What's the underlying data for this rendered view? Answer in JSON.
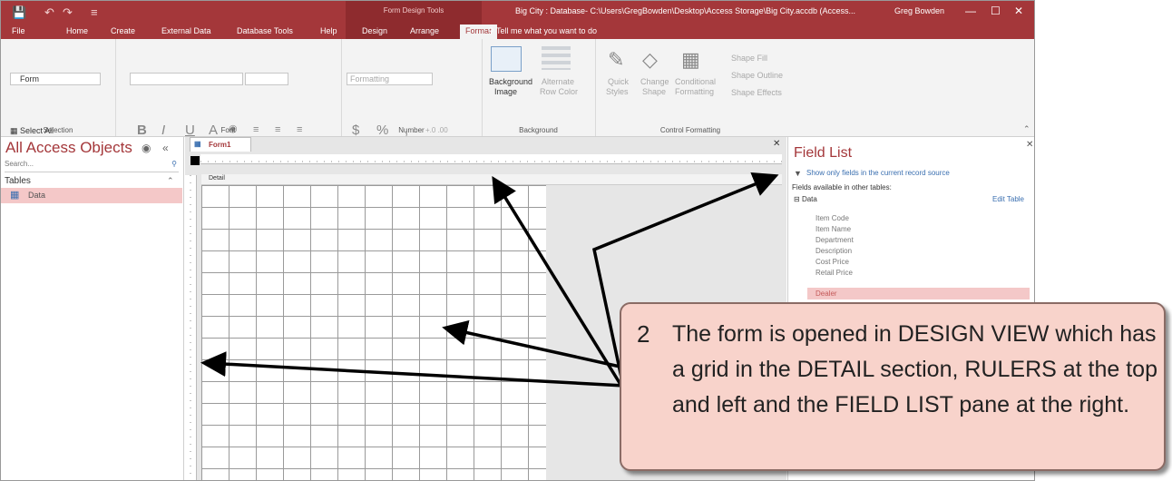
{
  "app": {
    "context_title": "Form Design Tools",
    "doc_title": "Big City : Database- C:\\Users\\GregBowden\\Desktop\\Access Storage\\Big City.accdb (Access...",
    "user": "Greg Bowden"
  },
  "tabs": [
    "File",
    "Home",
    "Create",
    "External Data",
    "Database Tools",
    "Help",
    "Design",
    "Arrange",
    "Format"
  ],
  "active_tab": "Format",
  "tell_me": "Tell me what you want to do",
  "ribbon": {
    "selection": {
      "object_value": "Form",
      "select_all": "Select All",
      "label": "Selection"
    },
    "font": {
      "bold": "B",
      "italic": "I",
      "underline": "U",
      "font_color": "A",
      "label": "Font"
    },
    "number": {
      "format_value": "Formatting",
      "currency": "$",
      "percent": "%",
      "comma": ",",
      "inc_decimals": "+.0 .00",
      "dec_decimals": ".00 →.0",
      "label": "Number"
    },
    "background": {
      "bg_image": "Background",
      "bg_image2": "Image",
      "alt_row": "Alternate",
      "alt_row2": "Row Color",
      "label": "Background"
    },
    "control": {
      "quick": "Quick",
      "quick2": "Styles",
      "change": "Change",
      "change2": "Shape",
      "cond": "Conditional",
      "cond2": "Formatting",
      "fill": "Shape Fill",
      "outline": "Shape Outline",
      "effects": "Shape Effects",
      "label": "Control Formatting"
    }
  },
  "nav": {
    "title": "All Access Objects",
    "search_placeholder": "Search...",
    "group": "Tables",
    "items": [
      {
        "label": "Data"
      }
    ]
  },
  "document": {
    "tab_label": "Form1",
    "section": "Detail"
  },
  "field_list": {
    "title": "Field List",
    "show_only": "Show only fields in the current record source",
    "subtitle": "Fields available in other tables:",
    "table": "Data",
    "edit_table": "Edit Table",
    "fields": [
      "Item Code",
      "Item Name",
      "Department",
      "Description",
      "Cost Price",
      "Retail Price",
      "Dealer"
    ],
    "selected": "Dealer"
  },
  "callout": {
    "number": "2",
    "text": "The form is opened in DESIGN VIEW which has a grid in the DETAIL section, RULERS at the top and left and the FIELD LIST pane at the right."
  },
  "colors": {
    "accent": "#a4373a",
    "callout_bg": "#f8d3cb"
  }
}
